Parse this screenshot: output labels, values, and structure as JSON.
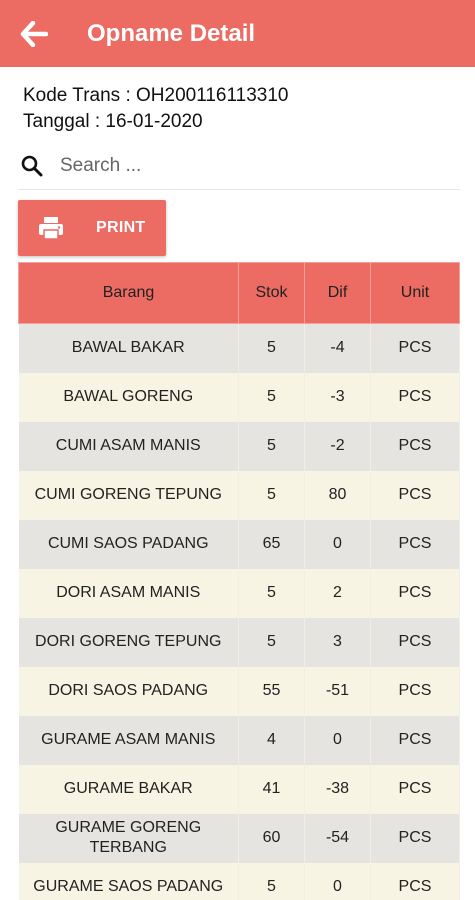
{
  "header": {
    "title": "Opname Detail",
    "back_icon": "arrow-left-icon"
  },
  "info": {
    "kode_trans": "Kode Trans : OH200116113310",
    "tanggal": "Tanggal : 16-01-2020"
  },
  "search": {
    "placeholder": "Search ...",
    "value": ""
  },
  "print_button": {
    "label": "PRINT"
  },
  "table": {
    "columns": [
      "Barang",
      "Stok",
      "Dif",
      "Unit"
    ],
    "rows": [
      {
        "barang": "BAWAL BAKAR",
        "stok": "5",
        "dif": "-4",
        "unit": "PCS"
      },
      {
        "barang": "BAWAL GORENG",
        "stok": "5",
        "dif": "-3",
        "unit": "PCS"
      },
      {
        "barang": "CUMI ASAM MANIS",
        "stok": "5",
        "dif": "-2",
        "unit": "PCS"
      },
      {
        "barang": "CUMI GORENG TEPUNG",
        "stok": "5",
        "dif": "80",
        "unit": "PCS"
      },
      {
        "barang": "CUMI SAOS PADANG",
        "stok": "65",
        "dif": "0",
        "unit": "PCS"
      },
      {
        "barang": "DORI ASAM MANIS",
        "stok": "5",
        "dif": "2",
        "unit": "PCS"
      },
      {
        "barang": "DORI GORENG TEPUNG",
        "stok": "5",
        "dif": "3",
        "unit": "PCS"
      },
      {
        "barang": "DORI SAOS PADANG",
        "stok": "55",
        "dif": "-51",
        "unit": "PCS"
      },
      {
        "barang": "GURAME ASAM MANIS",
        "stok": "4",
        "dif": "0",
        "unit": "PCS"
      },
      {
        "barang": "GURAME BAKAR",
        "stok": "41",
        "dif": "-38",
        "unit": "PCS"
      },
      {
        "barang": "GURAME GORENG TERBANG",
        "stok": "60",
        "dif": "-54",
        "unit": "PCS"
      },
      {
        "barang": "GURAME SAOS PADANG",
        "stok": "5",
        "dif": "0",
        "unit": "PCS"
      }
    ]
  },
  "colors": {
    "accent": "#ec6b63",
    "row_odd": "#e5e4e0",
    "row_even": "#f7f4e3"
  }
}
